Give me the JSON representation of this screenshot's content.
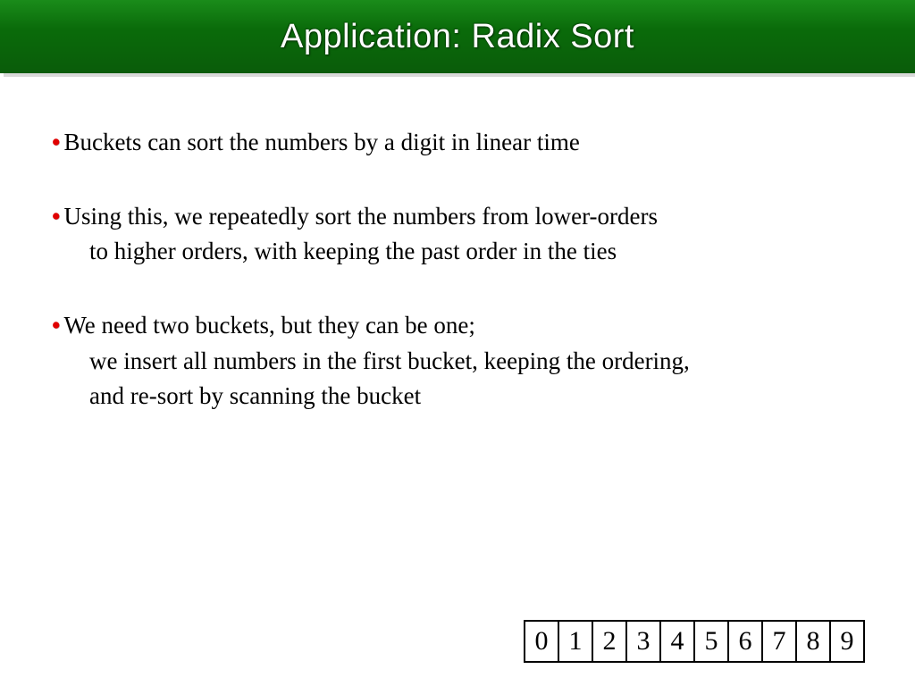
{
  "title": "Application: Radix Sort",
  "bullets": [
    {
      "line1": "Buckets can sort the numbers by a digit in linear time",
      "line2": "",
      "line3": ""
    },
    {
      "line1": "Using this, we repeatedly sort the numbers from lower-orders",
      "line2": "to higher orders, with keeping the past order in the ties",
      "line3": ""
    },
    {
      "line1": "We need two buckets, but they can be one;",
      "line2": "we insert all numbers in the first bucket, keeping the ordering,",
      "line3": "and re-sort by scanning the bucket"
    }
  ],
  "digits": [
    "0",
    "1",
    "2",
    "3",
    "4",
    "5",
    "6",
    "7",
    "8",
    "9"
  ]
}
